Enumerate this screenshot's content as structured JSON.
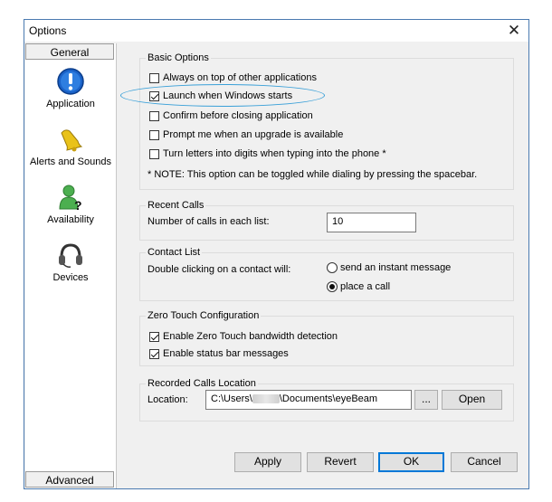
{
  "window": {
    "title": "Options"
  },
  "sidebar": {
    "top_button": "General",
    "bottom_button": "Advanced",
    "items": [
      {
        "label": "Application",
        "icon": "info-icon"
      },
      {
        "label": "Alerts and Sounds",
        "icon": "bell-icon"
      },
      {
        "label": "Availability",
        "icon": "availability-icon"
      },
      {
        "label": "Devices",
        "icon": "headset-icon"
      }
    ]
  },
  "basic": {
    "title": "Basic Options",
    "options": [
      {
        "label": "Always on top of other applications",
        "checked": false
      },
      {
        "label": "Launch when Windows starts",
        "checked": true
      },
      {
        "label": "Confirm before closing application",
        "checked": false
      },
      {
        "label": "Prompt me when an upgrade is available",
        "checked": false
      },
      {
        "label": "Turn letters into digits when typing into the phone *",
        "checked": false
      }
    ],
    "note": "* NOTE: This option can be toggled while dialing by pressing the spacebar."
  },
  "recent": {
    "title": "Recent Calls",
    "label": "Number of calls in each list:",
    "value": "10"
  },
  "contact": {
    "title": "Contact List",
    "label": "Double clicking on a contact will:",
    "options": [
      {
        "label": "send an instant message",
        "checked": false
      },
      {
        "label": "place a call",
        "checked": true
      }
    ]
  },
  "zero": {
    "title": "Zero Touch Configuration",
    "options": [
      {
        "label": "Enable Zero Touch bandwidth detection",
        "checked": true
      },
      {
        "label": "Enable status bar messages",
        "checked": true
      }
    ]
  },
  "recorded": {
    "title": "Recorded Calls Location",
    "label": "Location:",
    "path_prefix": "C:\\Users\\",
    "path_suffix": "\\Documents\\eyeBeam",
    "browse_label": "...",
    "open_label": "Open"
  },
  "footer": {
    "apply": "Apply",
    "revert": "Revert",
    "ok": "OK",
    "cancel": "Cancel"
  },
  "colors": {
    "highlight_oval": "#3aa0d8",
    "default_button_border": "#0078d7",
    "window_border": "#4a7ab0"
  }
}
